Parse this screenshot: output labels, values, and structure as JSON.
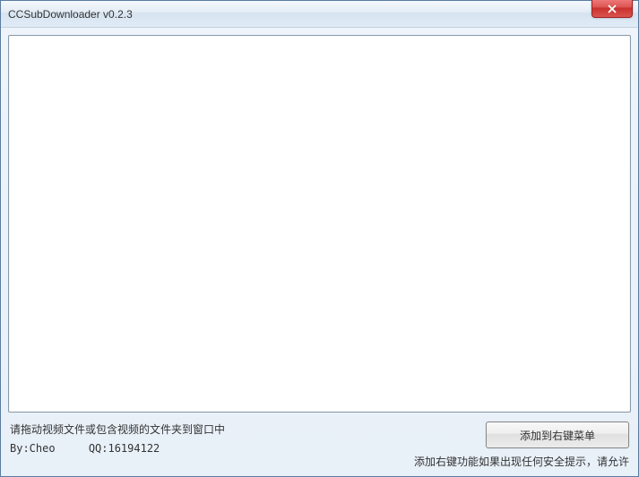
{
  "window": {
    "title": "CCSubDownloader v0.2.3"
  },
  "hint": "请拖动视频文件或包含视频的文件夹到窗口中",
  "author": {
    "by": "By:Cheo",
    "qq": "QQ:16194122"
  },
  "button": {
    "add_context": "添加到右键菜单"
  },
  "security_hint": "添加右键功能如果出现任何安全提示，请允许"
}
